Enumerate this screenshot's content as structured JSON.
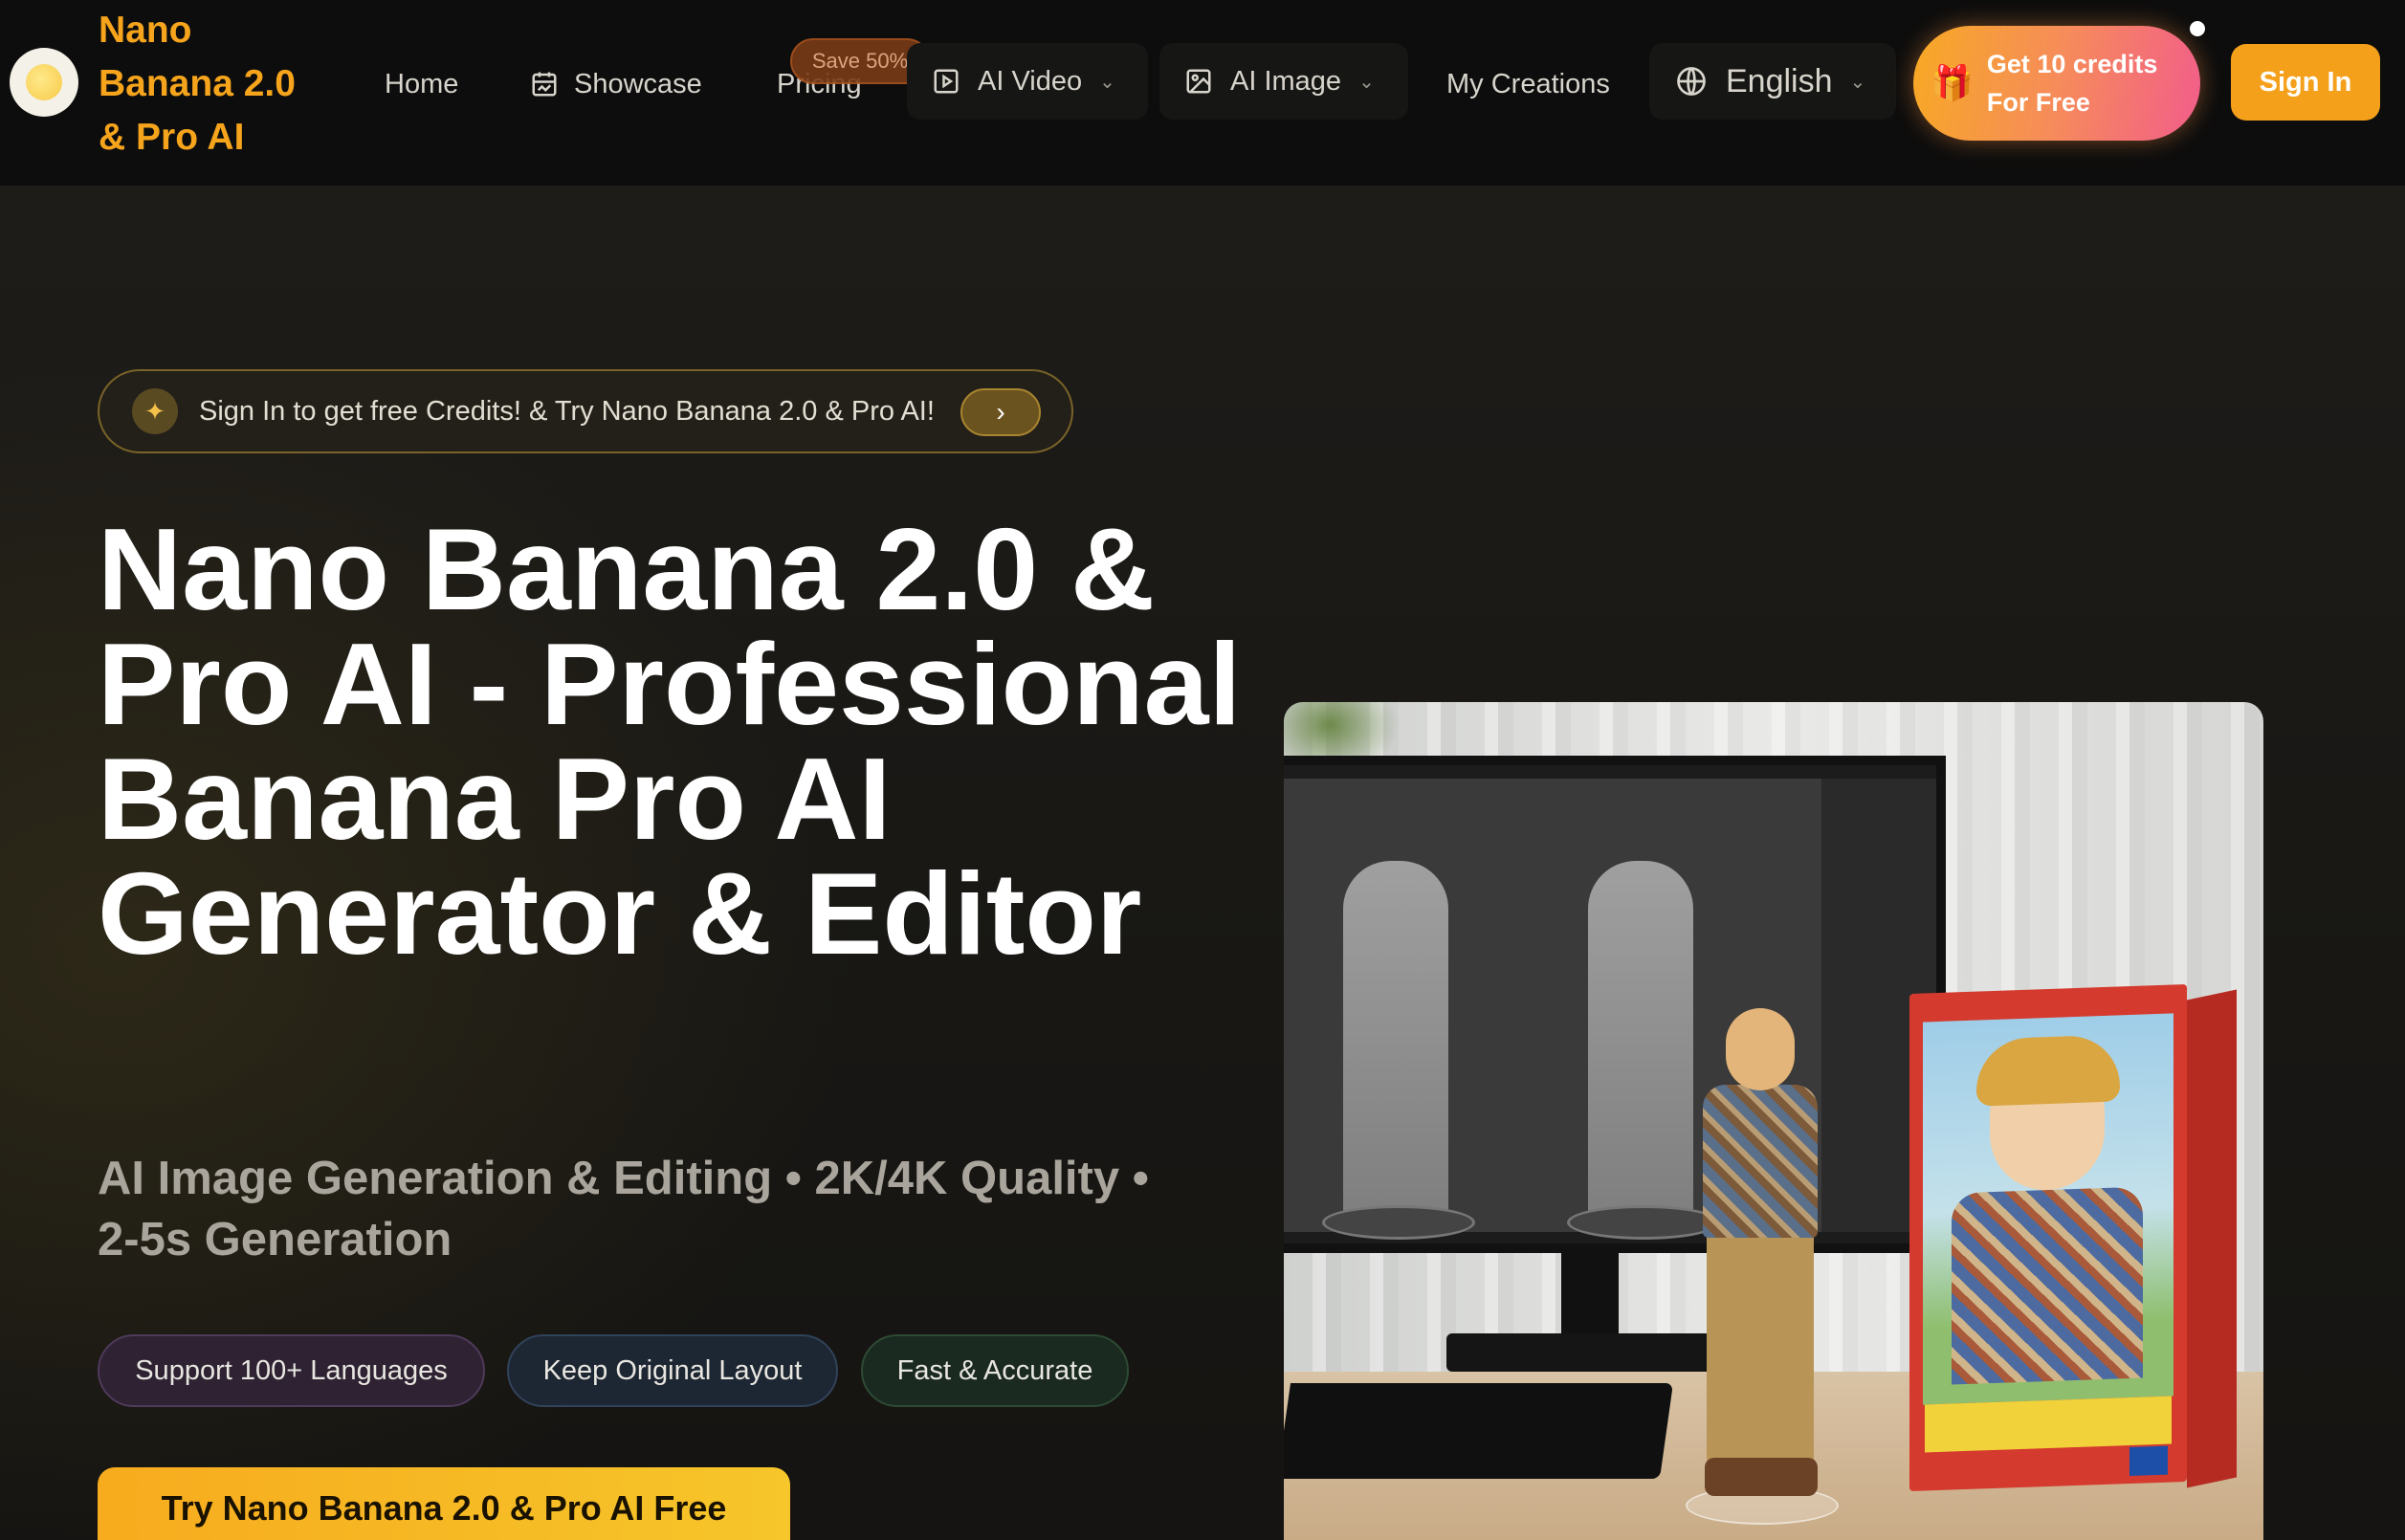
{
  "nav": {
    "brand": "Nano\nBanana 2.0\n& Pro AI",
    "home": "Home",
    "showcase": "Showcase",
    "pricing": "Pricing",
    "save_badge": "Save 50%",
    "ai_video": "AI Video",
    "ai_image": "AI Image",
    "my_creations": "My Creations",
    "language": "English",
    "credits_label": "Get 10 credits\nFor Free",
    "sign_in": "Sign In"
  },
  "hero": {
    "promo_text": "Sign In to get free Credits! & Try Nano Banana 2.0 & Pro AI!",
    "title": "Nano Banana 2.0 & Pro AI - Professional Banana Pro AI Generator & Editor",
    "subtitle": "AI Image Generation & Editing • 2K/4K Quality • 2-5s Generation",
    "tags": [
      "Support 100+ Languages",
      "Keep Original Layout",
      "Fast & Accurate"
    ],
    "cta": "Try Nano Banana 2.0 & Pro AI Free"
  },
  "colors": {
    "accent": "#f5a01a",
    "background": "#161513",
    "nav_background": "#0d0d0d"
  },
  "icons": {
    "showcase": "calendar-image-icon",
    "ai_video": "play-square-icon",
    "ai_image": "image-icon",
    "language": "globe-icon",
    "credits": "gift-icon",
    "promo": "sparkle-icon",
    "promo_go": "chevron-right-icon"
  }
}
